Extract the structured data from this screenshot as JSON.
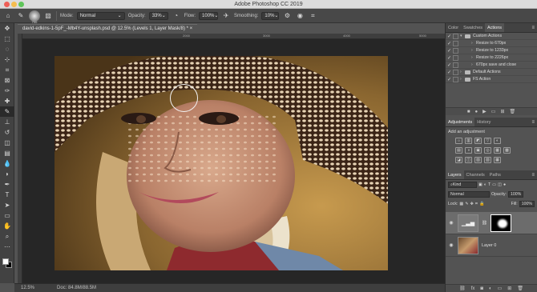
{
  "window": {
    "title": "Adobe Photoshop CC 2019"
  },
  "options_bar": {
    "brush_size": "700",
    "mode_label": "Mode:",
    "mode_value": "Normal",
    "opacity_label": "Opacity:",
    "opacity_value": "33%",
    "flow_label": "Flow:",
    "flow_value": "100%",
    "smoothing_label": "Smoothing:",
    "smoothing_value": "10%"
  },
  "document": {
    "tab_title": "david-edkins-1-5pF_-Mb4Y-unsplash.psd @ 12.5% (Levels 1, Layer Mask/8) *",
    "ruler_marks": [
      "2000",
      "3000",
      "4000",
      "5000"
    ]
  },
  "status": {
    "zoom": "12.5%",
    "doc_size": "Doc: 84.8M/88.5M"
  },
  "panels": {
    "top_tabs": [
      "Color",
      "Swatches",
      "Actions"
    ],
    "actions": [
      {
        "label": "Custom Actions",
        "indent": 0,
        "type": "set"
      },
      {
        "label": "Resize to 670px",
        "indent": 1,
        "type": "action"
      },
      {
        "label": "Resize to 1233px",
        "indent": 1,
        "type": "action"
      },
      {
        "label": "Resize to 2226px",
        "indent": 1,
        "type": "action"
      },
      {
        "label": "670px save and close",
        "indent": 1,
        "type": "action"
      },
      {
        "label": "Default Actions",
        "indent": 0,
        "type": "set"
      },
      {
        "label": "FS Action",
        "indent": 0,
        "type": "set"
      }
    ],
    "mid_tabs": [
      "Adjustments",
      "History"
    ],
    "adjustments_title": "Add an adjustment",
    "adjustment_icons_row1": [
      "☼",
      "▥",
      "◩",
      "▽",
      "◐"
    ],
    "adjustment_icons_row2": [
      "▤",
      "◑",
      "▣",
      "◎",
      "▦",
      "▩"
    ],
    "adjustment_icons_row3": [
      "◪",
      "◫",
      "▧",
      "▨",
      "▦"
    ],
    "layer_tabs": [
      "Layers",
      "Channels",
      "Paths"
    ],
    "layers": {
      "kind_label": "Kind",
      "blend_mode": "Normal",
      "opacity_label": "Opacity:",
      "opacity_value": "100%",
      "lock_label": "Lock:",
      "fill_label": "Fill:",
      "fill_value": "100%",
      "items": [
        {
          "name": ""
        },
        {
          "name": "Layer 0"
        }
      ]
    }
  },
  "colors": {
    "accent": "#2d8ceb",
    "panel_bg": "#535353",
    "chrome": "#424242"
  }
}
